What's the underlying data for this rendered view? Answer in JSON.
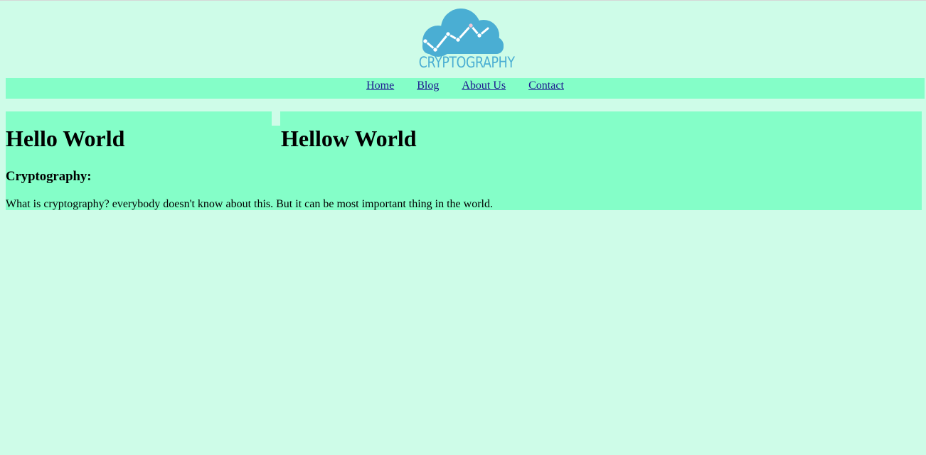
{
  "logo": {
    "text": "CRYPTOGRAPHY",
    "icon": "cloud-chart-icon",
    "colors": {
      "cloud": "#4aaed3",
      "line": "#ffffff"
    }
  },
  "nav": {
    "items": [
      {
        "label": "Home"
      },
      {
        "label": "Blog"
      },
      {
        "label": "About Us"
      },
      {
        "label": "Contact"
      }
    ]
  },
  "main": {
    "left_title": "Hello World",
    "right_title": "Hellow World",
    "subheading": "Cryptography:",
    "paragraph": "What is cryptography? everybody doesn't know about this. But it can be most important thing in the world."
  },
  "colors": {
    "page_background": "#cefce8",
    "panel_background": "#84fec8",
    "link": "#1e1a8f"
  }
}
